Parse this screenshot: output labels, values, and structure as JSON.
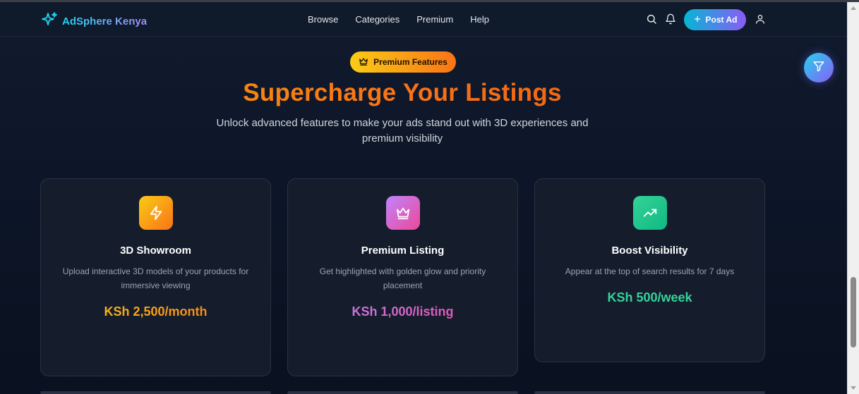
{
  "header": {
    "brand": "AdSphere Kenya",
    "nav": [
      "Browse",
      "Categories",
      "Premium",
      "Help"
    ],
    "post_ad_label": "Post Ad"
  },
  "hero": {
    "badge": "Premium Features",
    "title": "Supercharge Your Listings",
    "subtitle": "Unlock advanced features to make your ads stand out with 3D experiences and premium visibility"
  },
  "cards": [
    {
      "icon": "lightning-icon",
      "title": "3D Showroom",
      "description": "Upload interactive 3D models of your products for immersive viewing",
      "price": "KSh 2,500/month"
    },
    {
      "icon": "crown-icon",
      "title": "Premium Listing",
      "description": "Get highlighted with golden glow and priority placement",
      "price": "KSh 1,000/listing"
    },
    {
      "icon": "trending-up-icon",
      "title": "Boost Visibility",
      "description": "Appear at the top of search results for 7 days",
      "price": "KSh 500/week"
    }
  ],
  "colors": {
    "background": "#0d1525",
    "brand_gradient_start": "#22d3ee",
    "brand_gradient_end": "#8b5cf6",
    "premium_orange": "#f97316",
    "premium_gold": "#facc15",
    "price_purple": "#c084fc",
    "price_green": "#34d399"
  }
}
